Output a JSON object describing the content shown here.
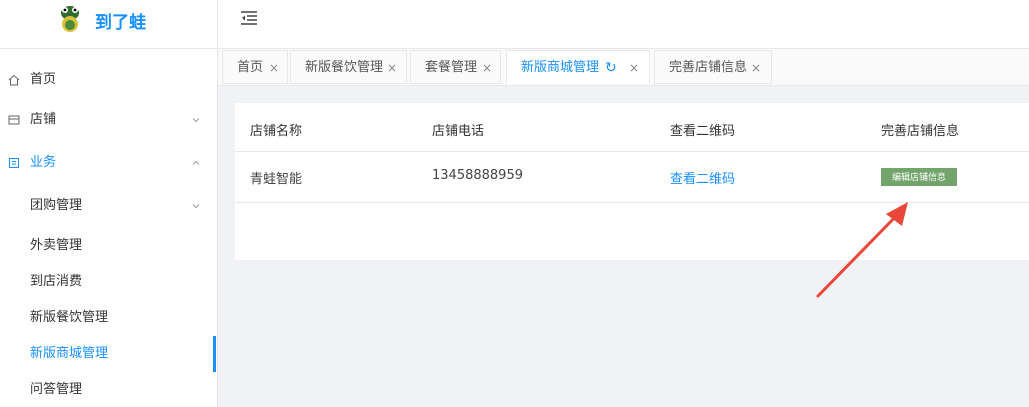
{
  "app": {
    "name": "到了蛙"
  },
  "sidebar": {
    "items": [
      {
        "label": "首页"
      },
      {
        "label": "店铺"
      },
      {
        "label": "业务"
      },
      {
        "label": "团购管理"
      },
      {
        "label": "外卖管理"
      },
      {
        "label": "到店消费"
      },
      {
        "label": "新版餐饮管理"
      },
      {
        "label": "新版商城管理"
      },
      {
        "label": "问答管理"
      }
    ]
  },
  "tabs": [
    {
      "label": "首页",
      "close": "×"
    },
    {
      "label": "新版餐饮管理",
      "close": "×"
    },
    {
      "label": "套餐管理",
      "close": "×"
    },
    {
      "label": "新版商城管理",
      "reload": "↻",
      "close": "×"
    },
    {
      "label": "完善店铺信息",
      "close": "×"
    }
  ],
  "table": {
    "headers": [
      "店铺名称",
      "店铺电话",
      "查看二维码",
      "完善店铺信息"
    ],
    "rows": [
      {
        "name": "青蛙智能",
        "phone": "13458888959",
        "qrcode": "查看二维码",
        "action": "编辑店铺信息"
      }
    ]
  },
  "colors": {
    "accent": "#1890ff",
    "button": "#72a46b",
    "arrow": "#e8473a"
  }
}
